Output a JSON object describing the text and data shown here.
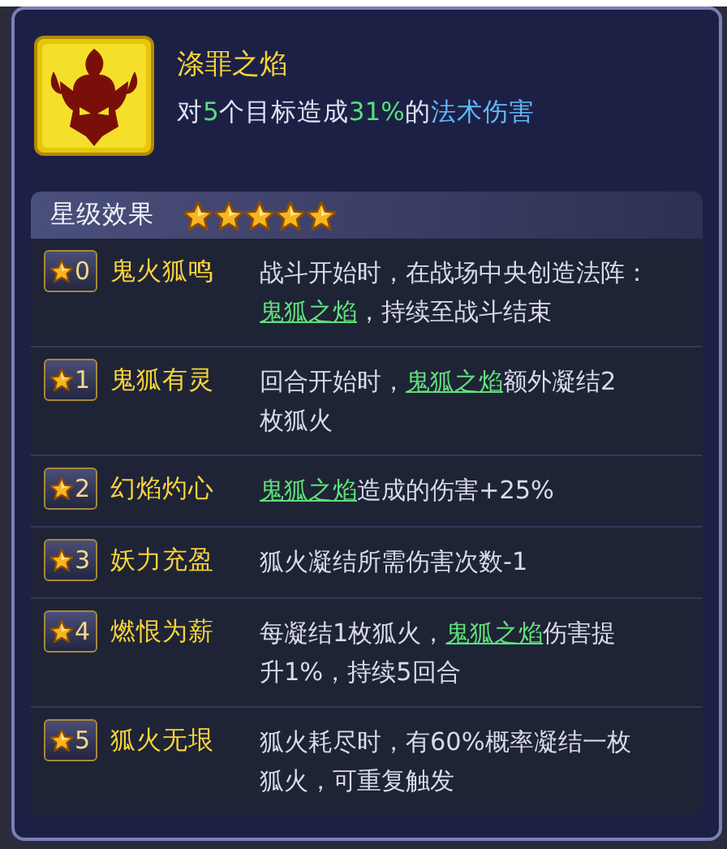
{
  "skill": {
    "title": "涤罪之焰",
    "description": [
      {
        "kind": "text",
        "text": "对"
      },
      {
        "kind": "number",
        "text": "5"
      },
      {
        "kind": "text",
        "text": "个目标造成"
      },
      {
        "kind": "number",
        "text": "31%"
      },
      {
        "kind": "text",
        "text": "的"
      },
      {
        "kind": "term",
        "text": "法术伤害"
      }
    ]
  },
  "star_effects": {
    "title": "星级效果",
    "stars": 5,
    "rows": [
      {
        "star": "0",
        "name": "鬼火狐鸣",
        "lines": [
          [
            {
              "kind": "text",
              "text": "战斗开始时，在战场中央创造法阵："
            }
          ],
          [
            {
              "kind": "link",
              "text": "鬼狐之焰"
            },
            {
              "kind": "text",
              "text": "，持续至战斗结束"
            }
          ]
        ]
      },
      {
        "star": "1",
        "name": "鬼狐有灵",
        "lines": [
          [
            {
              "kind": "text",
              "text": "回合开始时，"
            },
            {
              "kind": "link",
              "text": "鬼狐之焰"
            },
            {
              "kind": "text",
              "text": "额外凝结2"
            }
          ],
          [
            {
              "kind": "text",
              "text": "枚狐火"
            }
          ]
        ]
      },
      {
        "star": "2",
        "name": "幻焰灼心",
        "lines": [
          [
            {
              "kind": "link",
              "text": "鬼狐之焰"
            },
            {
              "kind": "text",
              "text": "造成的伤害+25%"
            }
          ]
        ]
      },
      {
        "star": "3",
        "name": "妖力充盈",
        "lines": [
          [
            {
              "kind": "text",
              "text": "狐火凝结所需伤害次数-1"
            }
          ]
        ]
      },
      {
        "star": "4",
        "name": "燃恨为薪",
        "lines": [
          [
            {
              "kind": "text",
              "text": "每凝结1枚狐火，"
            },
            {
              "kind": "link",
              "text": "鬼狐之焰"
            },
            {
              "kind": "text",
              "text": "伤害提"
            }
          ],
          [
            {
              "kind": "text",
              "text": "升1%，持续5回合"
            }
          ]
        ]
      },
      {
        "star": "5",
        "name": "狐火无垠",
        "lines": [
          [
            {
              "kind": "text",
              "text": "狐火耗尽时，有60%概率凝结一枚"
            }
          ],
          [
            {
              "kind": "text",
              "text": "狐火，可重复触发"
            }
          ]
        ]
      }
    ]
  }
}
